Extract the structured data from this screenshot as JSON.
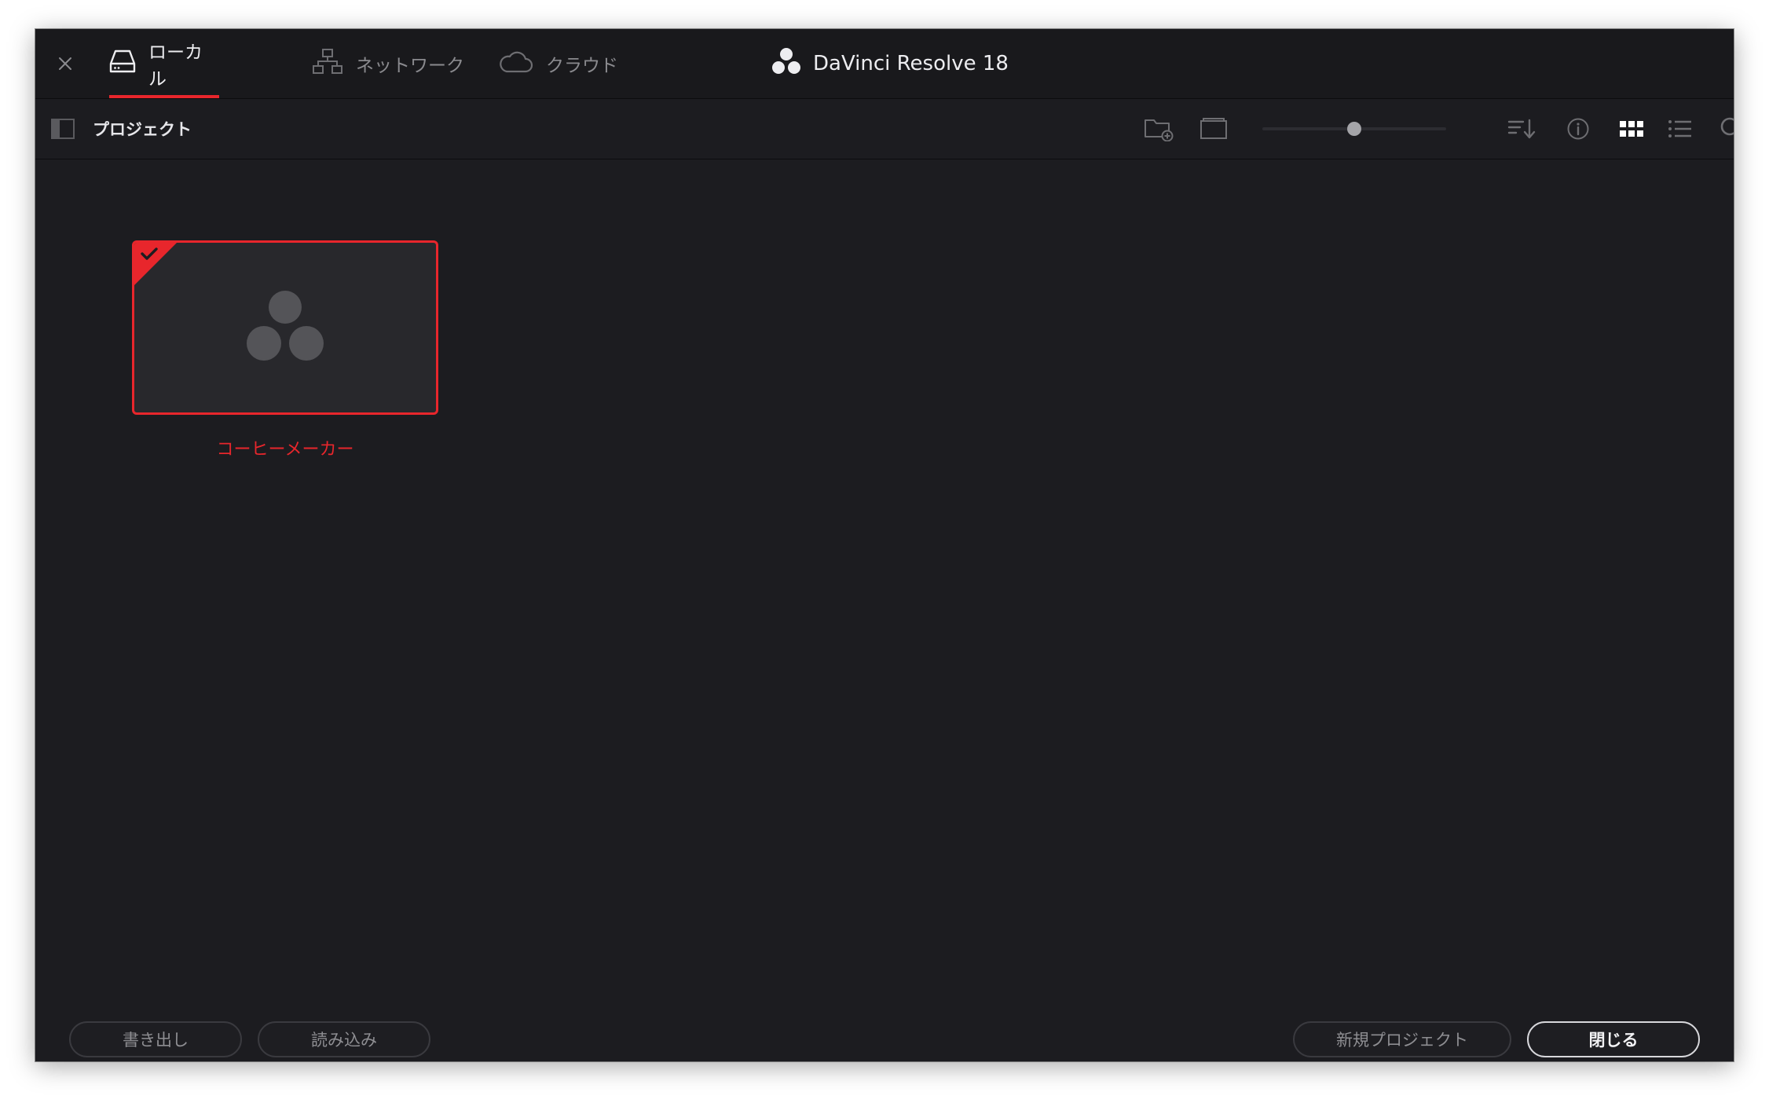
{
  "tabs": [
    {
      "label": "ローカル",
      "icon": "hard-drive-icon",
      "active": true
    },
    {
      "label": "ネットワーク",
      "icon": "network-icon",
      "active": false
    },
    {
      "label": "クラウド",
      "icon": "cloud-icon",
      "active": false
    }
  ],
  "app": {
    "title": "DaVinci Resolve 18",
    "icon": "davinci-logo-icon"
  },
  "toolbar": {
    "breadcrumb": "プロジェクト",
    "thumbnail_size_slider": 0.5
  },
  "projects": [
    {
      "name": "コーヒーメーカー",
      "selected": true
    }
  ],
  "footer": {
    "export_label": "書き出し",
    "import_label": "読み込み",
    "new_project_label": "新規プロジェクト",
    "close_label": "閉じる"
  },
  "colors": {
    "accent": "#e8262c",
    "background": "#1c1c20",
    "titlebar": "#19191c"
  }
}
